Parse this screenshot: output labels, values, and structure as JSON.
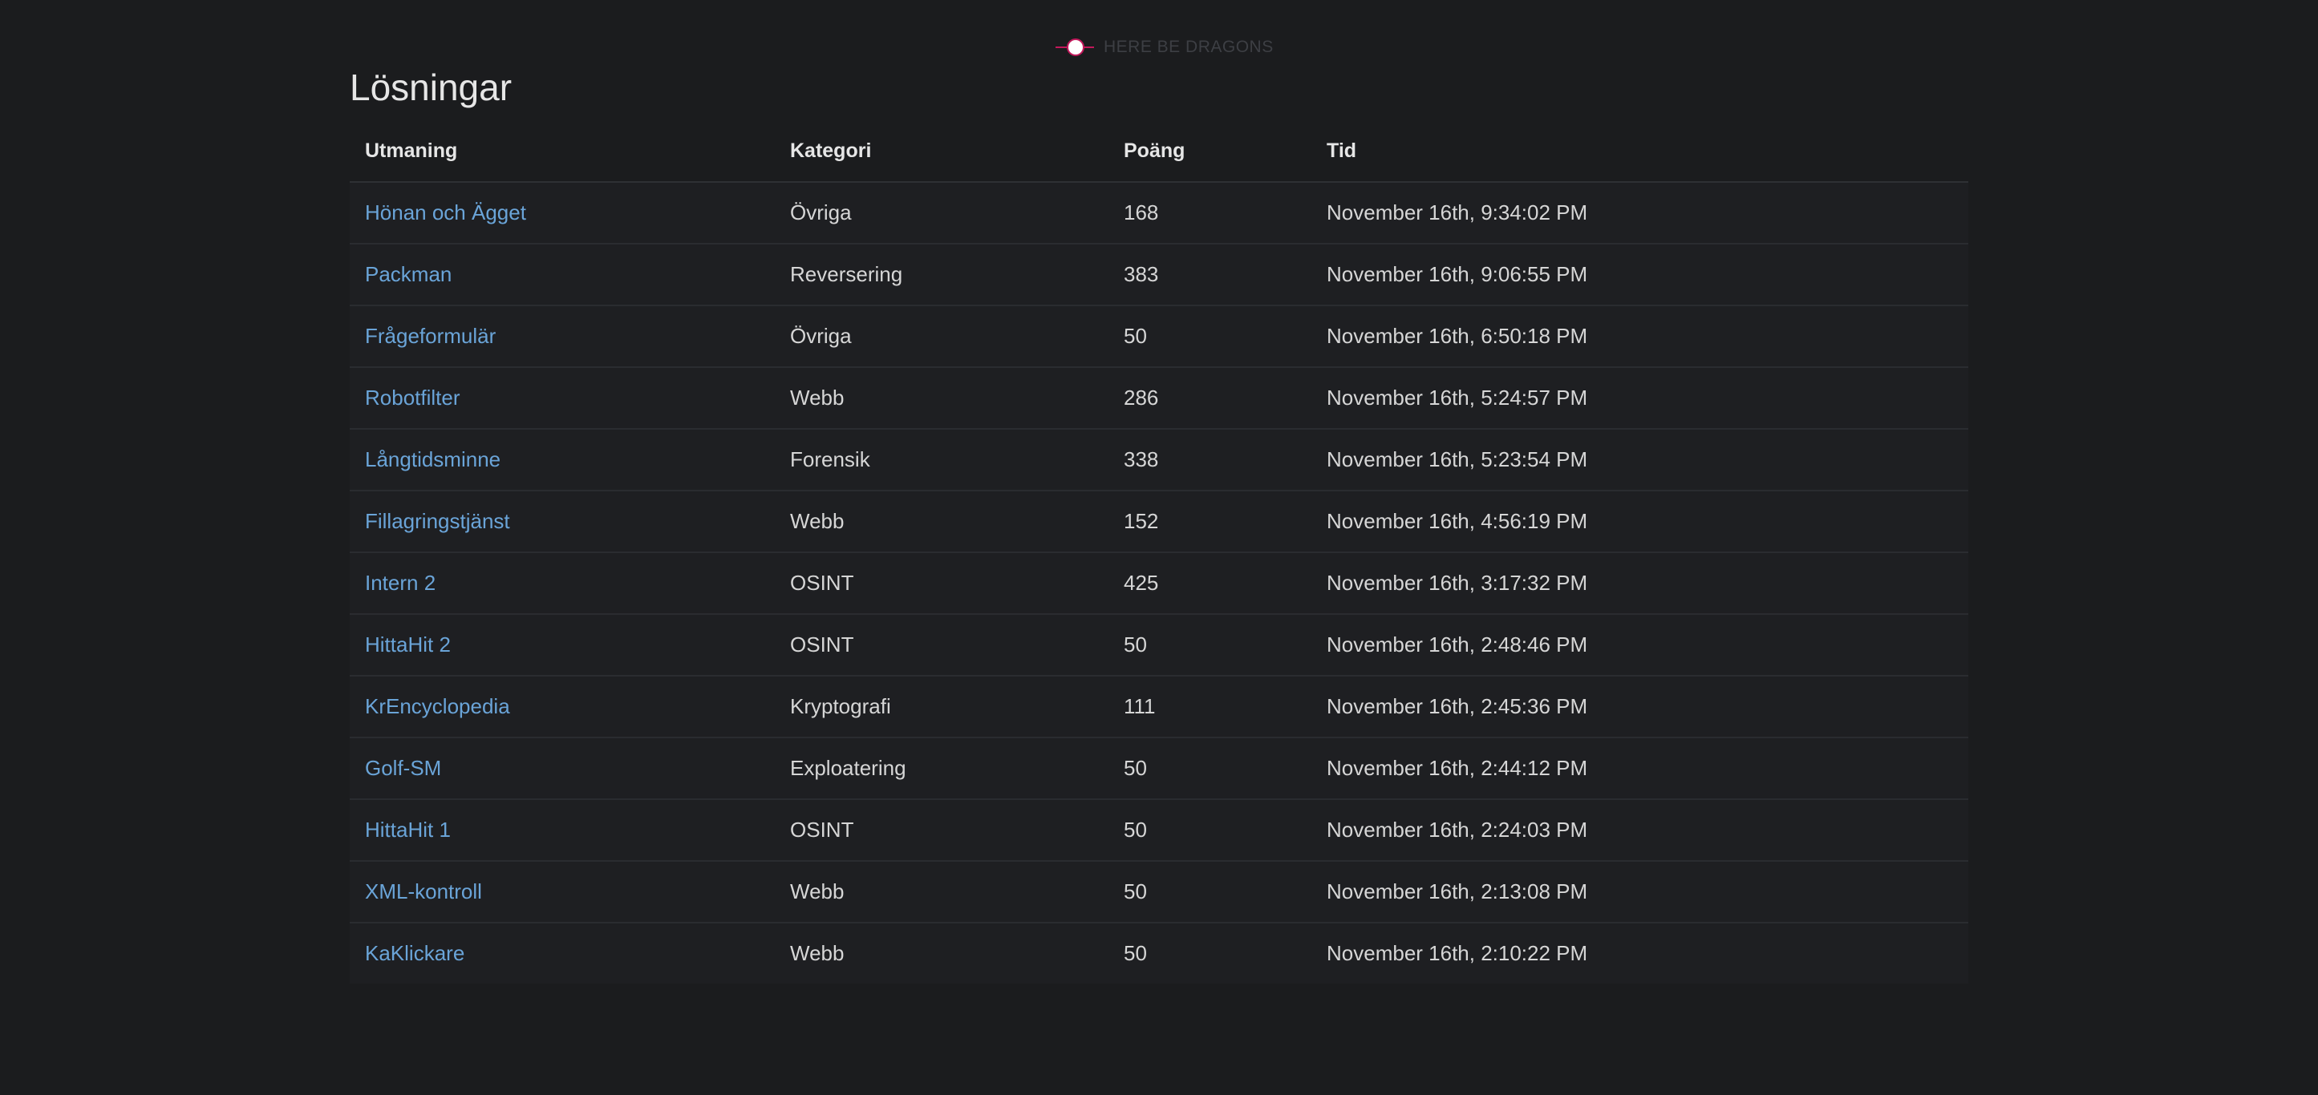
{
  "header": {
    "logo_text": "HERE BE DRAGONS",
    "page_title": "Lösningar"
  },
  "colors": {
    "background": "#1b1c1e",
    "link": "#6aa4d8",
    "logo_accent": "#c2185b"
  },
  "table": {
    "headers": {
      "challenge": "Utmaning",
      "category": "Kategori",
      "points": "Poäng",
      "time": "Tid"
    },
    "rows": [
      {
        "challenge": "Hönan och Ägget",
        "category": "Övriga",
        "points": "168",
        "time": "November 16th, 9:34:02 PM"
      },
      {
        "challenge": "Packman",
        "category": "Reversering",
        "points": "383",
        "time": "November 16th, 9:06:55 PM"
      },
      {
        "challenge": "Frågeformulär",
        "category": "Övriga",
        "points": "50",
        "time": "November 16th, 6:50:18 PM"
      },
      {
        "challenge": "Robotfilter",
        "category": "Webb",
        "points": "286",
        "time": "November 16th, 5:24:57 PM"
      },
      {
        "challenge": "Långtidsminne",
        "category": "Forensik",
        "points": "338",
        "time": "November 16th, 5:23:54 PM"
      },
      {
        "challenge": "Fillagringstjänst",
        "category": "Webb",
        "points": "152",
        "time": "November 16th, 4:56:19 PM"
      },
      {
        "challenge": "Intern 2",
        "category": "OSINT",
        "points": "425",
        "time": "November 16th, 3:17:32 PM"
      },
      {
        "challenge": "HittaHit 2",
        "category": "OSINT",
        "points": "50",
        "time": "November 16th, 2:48:46 PM"
      },
      {
        "challenge": "KrEncyclopedia",
        "category": "Kryptografi",
        "points": "111",
        "time": "November 16th, 2:45:36 PM"
      },
      {
        "challenge": "Golf-SM",
        "category": "Exploatering",
        "points": "50",
        "time": "November 16th, 2:44:12 PM"
      },
      {
        "challenge": "HittaHit 1",
        "category": "OSINT",
        "points": "50",
        "time": "November 16th, 2:24:03 PM"
      },
      {
        "challenge": "XML-kontroll",
        "category": "Webb",
        "points": "50",
        "time": "November 16th, 2:13:08 PM"
      },
      {
        "challenge": "KaKlickare",
        "category": "Webb",
        "points": "50",
        "time": "November 16th, 2:10:22 PM"
      }
    ]
  }
}
